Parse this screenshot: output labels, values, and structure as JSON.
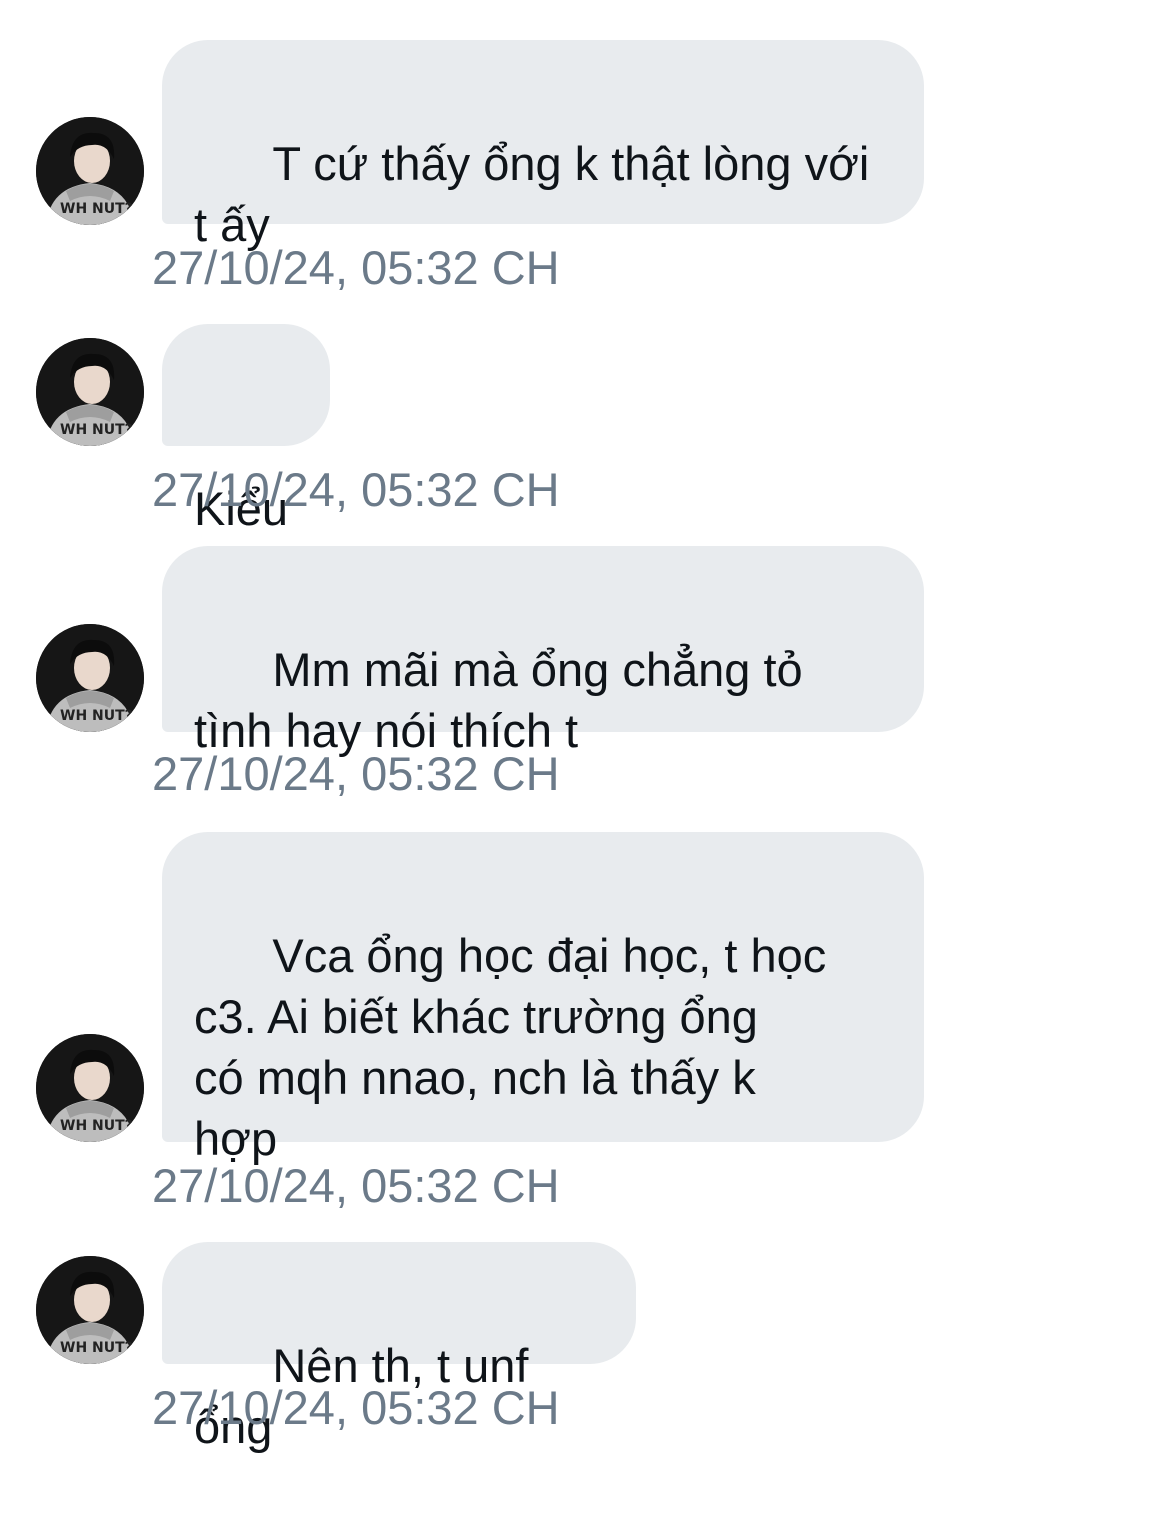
{
  "messages": [
    {
      "text": "T cứ thấy ổng k thật lòng với\nt ấy",
      "timestamp": "27/10/24, 05:32 CH"
    },
    {
      "text": "Kiểu",
      "timestamp": "27/10/24, 05:32 CH"
    },
    {
      "text": "Mm mãi mà ổng chẳng tỏ\ntình hay nói thích t",
      "timestamp": "27/10/24, 05:32 CH"
    },
    {
      "text": "Vca ổng học đại học, t học\nc3. Ai biết khác trường ổng\ncó mqh nnao, nch là thấy k\nhợp",
      "timestamp": "27/10/24, 05:32 CH"
    },
    {
      "text": "Nên th, t unf ổng",
      "timestamp": "27/10/24, 05:32 CH"
    }
  ],
  "avatar_icon": "user-avatar-photo",
  "colors": {
    "bubble": "#e8ebee",
    "text": "#0f1419",
    "timestamp": "#6b7a89",
    "background": "#ffffff"
  }
}
